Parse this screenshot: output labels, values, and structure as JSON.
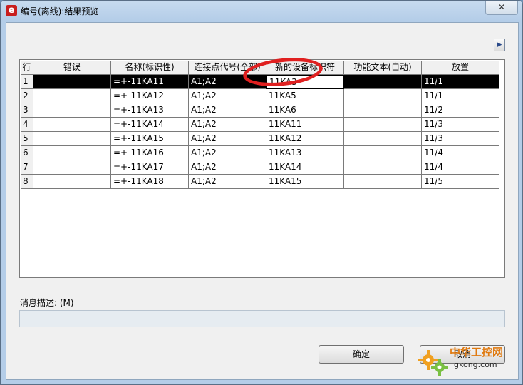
{
  "window": {
    "icon_glyph": "e",
    "title": "编号(离线):结果预览",
    "close_glyph": "✕"
  },
  "expand_glyph": "▶",
  "grid": {
    "columns": [
      {
        "label": "行",
        "width": 18
      },
      {
        "label": "错误",
        "width": 109
      },
      {
        "label": "名称(标识性)",
        "width": 109
      },
      {
        "label": "连接点代号(全部)",
        "width": 109
      },
      {
        "label": "新的设备标识符",
        "width": 109
      },
      {
        "label": "功能文本(自动)",
        "width": 109
      },
      {
        "label": "放置",
        "width": 109
      }
    ],
    "rows": [
      [
        "1",
        "",
        "=+-11KA11",
        "A1;A2",
        "11KA3",
        "",
        "11/1"
      ],
      [
        "2",
        "",
        "=+-11KA12",
        "A1;A2",
        "11KA5",
        "",
        "11/1"
      ],
      [
        "3",
        "",
        "=+-11KA13",
        "A1;A2",
        "11KA6",
        "",
        "11/2"
      ],
      [
        "4",
        "",
        "=+-11KA14",
        "A1;A2",
        "11KA11",
        "",
        "11/3"
      ],
      [
        "5",
        "",
        "=+-11KA15",
        "A1;A2",
        "11KA12",
        "",
        "11/3"
      ],
      [
        "6",
        "",
        "=+-11KA16",
        "A1;A2",
        "11KA13",
        "",
        "11/4"
      ],
      [
        "7",
        "",
        "=+-11KA17",
        "A1;A2",
        "11KA14",
        "",
        "11/4"
      ],
      [
        "8",
        "",
        "=+-11KA18",
        "A1;A2",
        "11KA15",
        "",
        "11/5"
      ]
    ],
    "selected_row": 0,
    "editing_column": 4
  },
  "message": {
    "label": "消息描述: (M)",
    "value": ""
  },
  "buttons": {
    "ok": "确定",
    "cancel": "取消"
  },
  "watermark": {
    "line1": "中华工控网",
    "line2": "gkong.com"
  },
  "colors": {
    "selection": "#000000",
    "highlight_ring": "#e02020",
    "title_bg": "#c7dbef"
  }
}
